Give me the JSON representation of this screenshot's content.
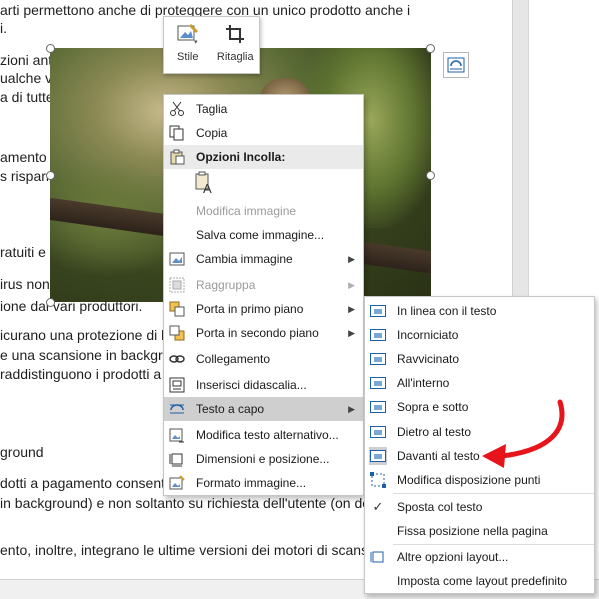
{
  "document": {
    "lines": [
      "arti permettono anche di proteggere con un unico prodotto anche i",
      "i.",
      "zioni anti",
      "ualche vo",
      "a di tutte",
      "amento",
      "s risparm",
      "ratuiti e a",
      "irus non",
      "ione dai vari produttori.",
      "icurano una protezione di b",
      "e una scansione in backgrou",
      "raddistinguono i prodotti a",
      "ground",
      "dotti a pagamento consente",
      "in background) e non soltanto su richiesta dell'utente (on dem",
      "ento, inoltre, integrano le ultime versioni dei motori di scansio"
    ]
  },
  "mini_toolbar": {
    "stile_label": "Stile",
    "ritaglia_label": "Ritaglia"
  },
  "context_menu": {
    "items": [
      {
        "label": "Taglia",
        "icon": "scissors-icon"
      },
      {
        "label": "Copia",
        "icon": "copy-icon"
      },
      {
        "label": "Opzioni Incolla:",
        "icon": "paste-options-icon"
      },
      {
        "label": "",
        "icon": "paste-text-only-icon"
      },
      {
        "label": "Modifica immagine",
        "icon": ""
      },
      {
        "label": "Salva come immagine...",
        "icon": ""
      },
      {
        "label": "Cambia immagine",
        "icon": "change-picture-icon"
      },
      {
        "label": "Raggruppa",
        "icon": "group-icon"
      },
      {
        "label": "Porta in primo piano",
        "icon": "bring-forward-icon"
      },
      {
        "label": "Porta in secondo piano",
        "icon": "send-backward-icon"
      },
      {
        "label": "Collegamento",
        "icon": "link-icon"
      },
      {
        "label": "Inserisci didascalia...",
        "icon": "caption-icon"
      },
      {
        "label": "Testo a capo",
        "icon": "wrap-text-icon"
      },
      {
        "label": "Modifica testo alternativo...",
        "icon": "alt-text-icon"
      },
      {
        "label": "Dimensioni e posizione...",
        "icon": "size-position-icon"
      },
      {
        "label": "Formato immagine...",
        "icon": "format-picture-icon"
      }
    ]
  },
  "submenu": {
    "items": [
      {
        "label": "In linea con il testo"
      },
      {
        "label": "Incorniciato"
      },
      {
        "label": "Ravvicinato"
      },
      {
        "label": "All'interno"
      },
      {
        "label": "Sopra e sotto"
      },
      {
        "label": "Dietro al testo"
      },
      {
        "label": "Davanti al testo"
      },
      {
        "label": "Modifica disposizione punti"
      },
      {
        "label": "Sposta col testo"
      },
      {
        "label": "Fissa posizione nella pagina"
      },
      {
        "label": "Altre opzioni layout..."
      },
      {
        "label": "Imposta come layout predefinito"
      }
    ]
  },
  "colors": {
    "annotation_arrow": "#e8141b",
    "wrap_icon_blue": "#1f5fa8"
  }
}
